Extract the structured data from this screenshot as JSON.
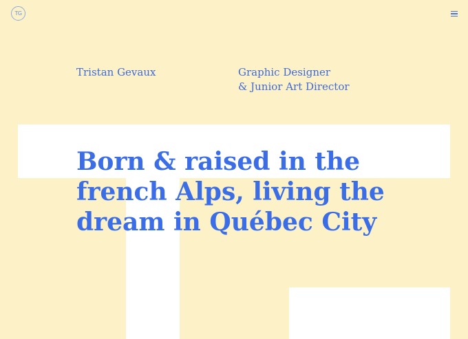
{
  "header": {
    "logo_text": "TG",
    "logo_icon": "monogram-circle-icon",
    "menu_icon": "hamburger-menu-icon"
  },
  "intro": {
    "name": "Tristan Gevaux",
    "role_lines": [
      "Graphic Designer",
      "& Junior Art Director"
    ]
  },
  "hero": {
    "headline_lines": [
      "Born & raised in the",
      "french Alps, living the",
      "dream in Québec City"
    ]
  },
  "colors": {
    "background": "#fdf2c7",
    "accent": "#3b6ee6",
    "shape": "#ffffff"
  }
}
